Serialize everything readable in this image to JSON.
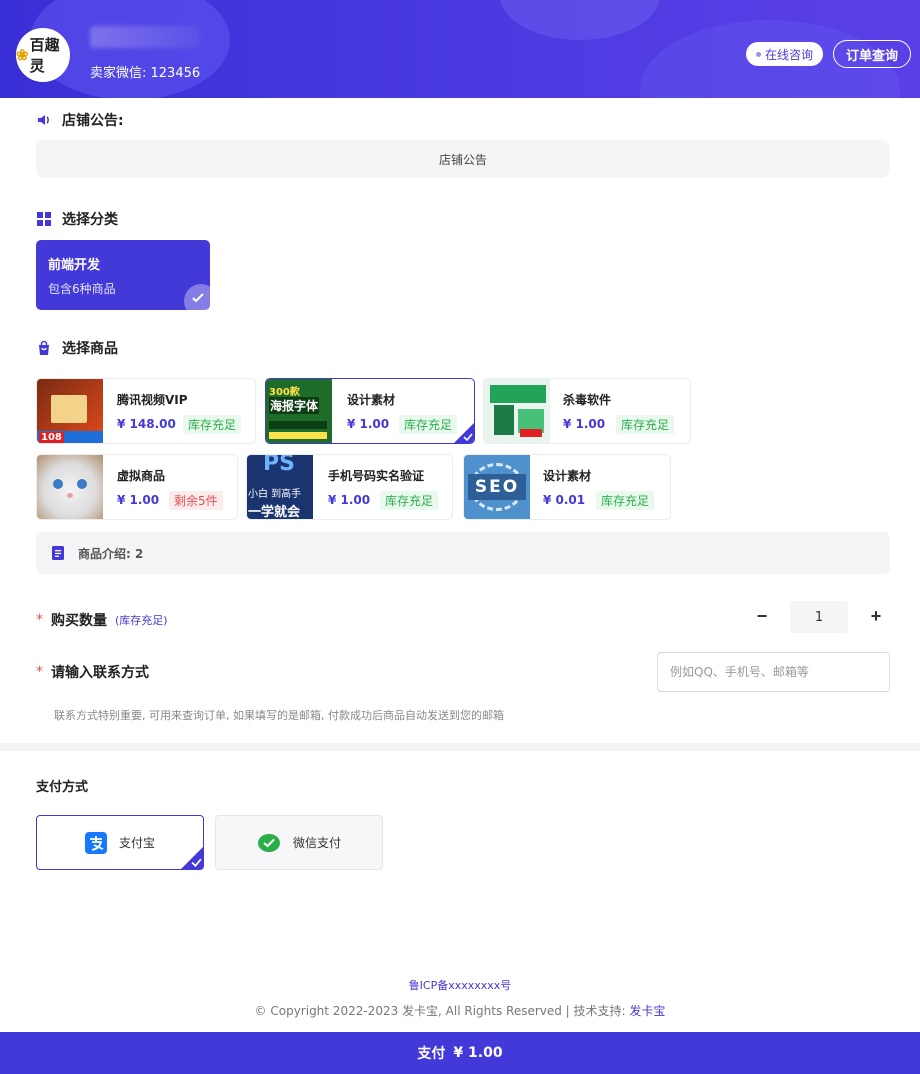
{
  "header": {
    "logo_text": "百趣灵",
    "seller_wechat": "卖家微信: 123456",
    "consult_label": "在线咨询",
    "order_query_label": "订单查询"
  },
  "notice": {
    "title": "店铺公告:",
    "content": "店铺公告"
  },
  "category": {
    "title": "选择分类",
    "items": [
      {
        "name": "前端开发",
        "count_text": "包含6种商品"
      }
    ]
  },
  "products": {
    "title": "选择商品",
    "items": [
      {
        "name": "腾讯视频VIP",
        "price": "¥ 148.00",
        "stock": "库存充足"
      },
      {
        "name": "设计素材",
        "price": "¥ 1.00",
        "stock": "库存充足"
      },
      {
        "name": "杀毒软件",
        "price": "¥ 1.00",
        "stock": "库存充足"
      },
      {
        "name": "虚拟商品",
        "price": "¥ 1.00",
        "stock": "剩余5件"
      },
      {
        "name": "手机号码实名验证",
        "price": "¥ 1.00",
        "stock": "库存充足"
      },
      {
        "name": "设计素材",
        "price": "¥ 0.01",
        "stock": "库存充足"
      }
    ],
    "thumbs": {
      "p1_badge": "108",
      "p2_line1": "300款",
      "p2_line2": "海报字体",
      "p5_big": "PS",
      "p5_line1": "小白 到高手",
      "p5_line2": "一学就会",
      "p6_text": "SEO"
    },
    "intro": "商品介绍: 2"
  },
  "quantity": {
    "label": "购买数量",
    "stock_hint": "(库存充足)",
    "value": "1",
    "minus": "−",
    "plus": "+"
  },
  "contact": {
    "label": "请输入联系方式",
    "placeholder": "例如QQ、手机号、邮箱等",
    "hint": "联系方式特别重要, 可用来查询订单, 如果填写的是邮箱, 付款成功后商品自动发送到您的邮箱"
  },
  "payment": {
    "title": "支付方式",
    "options": [
      {
        "label": "支付宝"
      },
      {
        "label": "微信支付"
      }
    ]
  },
  "footer": {
    "icp": "鲁ICP备xxxxxxxx号",
    "copyright": "© Copyright 2022-2023 发卡宝, All Rights Reserved | 技术支持:",
    "support_link": "发卡宝"
  },
  "pay_button": {
    "label": "支付",
    "amount": "¥ 1.00"
  },
  "colors": {
    "accent": "#4338d8",
    "stock_ok": "#2eae4e",
    "stock_low": "#e25454",
    "required": "#e25454"
  }
}
